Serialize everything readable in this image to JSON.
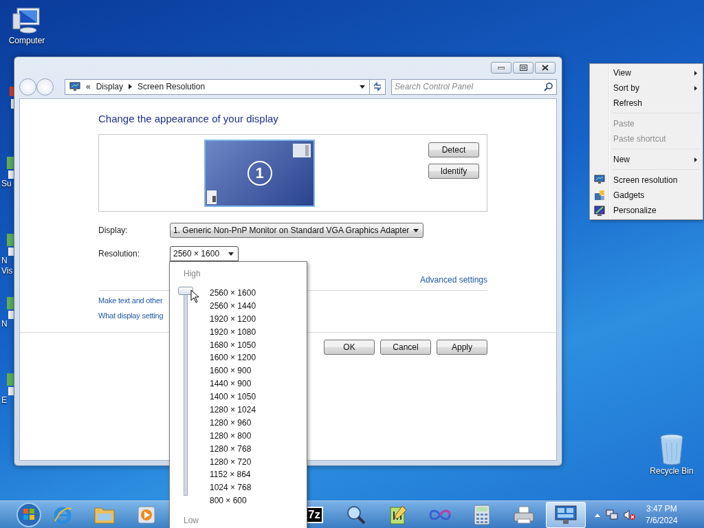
{
  "desktop": {
    "computer_label": "Computer",
    "recycle_bin_label": "Recycle Bin",
    "partial_icons": [
      {
        "label": "Su"
      },
      {
        "label": "N Vis"
      },
      {
        "label": "N"
      },
      {
        "label": "E"
      }
    ]
  },
  "window": {
    "breadcrumb_prefix": "«",
    "breadcrumb": [
      "Display",
      "Screen Resolution"
    ],
    "search_placeholder": "Search Control Panel",
    "heading": "Change the appearance of your display",
    "monitor_number": "1",
    "preview_buttons": [
      "Detect",
      "Identify"
    ],
    "display": {
      "label": "Display:",
      "value": "1. Generic Non-PnP Monitor on Standard VGA Graphics Adapter"
    },
    "resolution": {
      "label": "Resolution:",
      "value": "2560 × 1600",
      "expanded": true
    },
    "advanced_link": "Advanced settings",
    "links": [
      "Make text and other",
      "What display setting"
    ],
    "buttons": [
      "OK",
      "Cancel",
      "Apply"
    ]
  },
  "resolution_popup": {
    "high_label": "High",
    "low_label": "Low",
    "level": 1,
    "options": [
      "2560 × 1600",
      "2560 × 1440",
      "1920 × 1200",
      "1920 × 1080",
      "1680 × 1050",
      "1600 × 1200",
      "1600 × 900",
      "1440 × 900",
      "1400 × 1050",
      "1280 × 1024",
      "1280 × 960",
      "1280 × 800",
      "1280 × 768",
      "1280 × 720",
      "1152 × 864",
      "1024 × 768",
      "800 × 600"
    ]
  },
  "context_menu": {
    "items": [
      {
        "kind": "item",
        "label": "View",
        "disabled": false,
        "submenu": true
      },
      {
        "kind": "item",
        "label": "Sort by",
        "disabled": false,
        "submenu": true
      },
      {
        "kind": "item",
        "label": "Refresh",
        "disabled": false,
        "submenu": false
      },
      {
        "kind": "separator"
      },
      {
        "kind": "item",
        "label": "Paste",
        "disabled": true,
        "submenu": false
      },
      {
        "kind": "item",
        "label": "Paste shortcut",
        "disabled": true,
        "submenu": false
      },
      {
        "kind": "separator"
      },
      {
        "kind": "item",
        "label": "New",
        "disabled": false,
        "submenu": true
      },
      {
        "kind": "separator"
      },
      {
        "kind": "display-item",
        "label": "Screen resolution",
        "disabled": false,
        "submenu": false
      },
      {
        "kind": "gadgets-item",
        "label": "Gadgets",
        "disabled": false,
        "submenu": false
      },
      {
        "kind": "personalize-item",
        "label": "Personalize",
        "disabled": false,
        "submenu": false
      }
    ]
  },
  "taskbar": {
    "buttons": [
      {
        "kind": "browser",
        "active": false
      },
      {
        "kind": "folder",
        "active": false
      },
      {
        "kind": "media",
        "active": false
      },
      {
        "kind": "archiver",
        "label": "7z",
        "active": false
      },
      {
        "kind": "magnifier",
        "active": false
      },
      {
        "kind": "notepad",
        "active": false
      },
      {
        "kind": "infinity",
        "active": false
      },
      {
        "kind": "calculator",
        "active": false
      },
      {
        "kind": "printer",
        "active": false
      },
      {
        "kind": "display",
        "active": true
      }
    ],
    "clock": {
      "time": "3:47 PM",
      "date": "7/6/2024"
    }
  }
}
